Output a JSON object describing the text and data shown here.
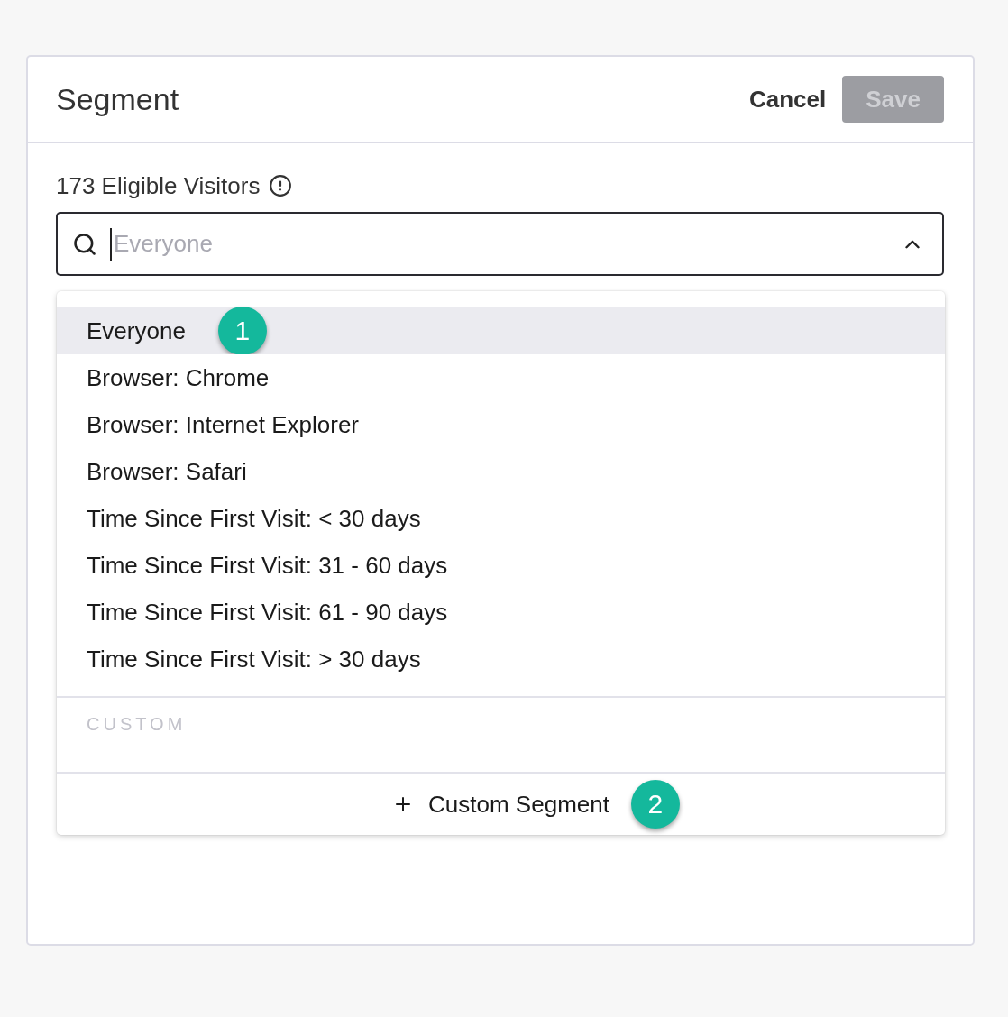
{
  "dialog": {
    "title": "Segment",
    "actions": [
      {
        "label": "Cancel",
        "kind": "link",
        "disabled": false
      },
      {
        "label": "Save",
        "kind": "primary",
        "disabled": true
      }
    ]
  },
  "eligible": {
    "label": "173 Eligible Visitors"
  },
  "search": {
    "placeholder": "Everyone",
    "focused": true,
    "expanded": true
  },
  "options": [
    {
      "label": "Everyone",
      "selected": true,
      "callout": "1"
    },
    {
      "label": "Browser: Chrome",
      "selected": false
    },
    {
      "label": "Browser: Internet Explorer",
      "selected": false
    },
    {
      "label": "Browser: Safari",
      "selected": false
    },
    {
      "label": "Time Since First Visit: < 30 days",
      "selected": false
    },
    {
      "label": "Time Since First Visit: 31 - 60 days",
      "selected": false
    },
    {
      "label": "Time Since First Visit: 61 - 90 days",
      "selected": false
    },
    {
      "label": "Time Since First Visit: > 30 days",
      "selected": false
    }
  ],
  "custom_section": {
    "heading": "CUSTOM"
  },
  "footer": {
    "label": "Custom Segment",
    "callout": "2"
  }
}
